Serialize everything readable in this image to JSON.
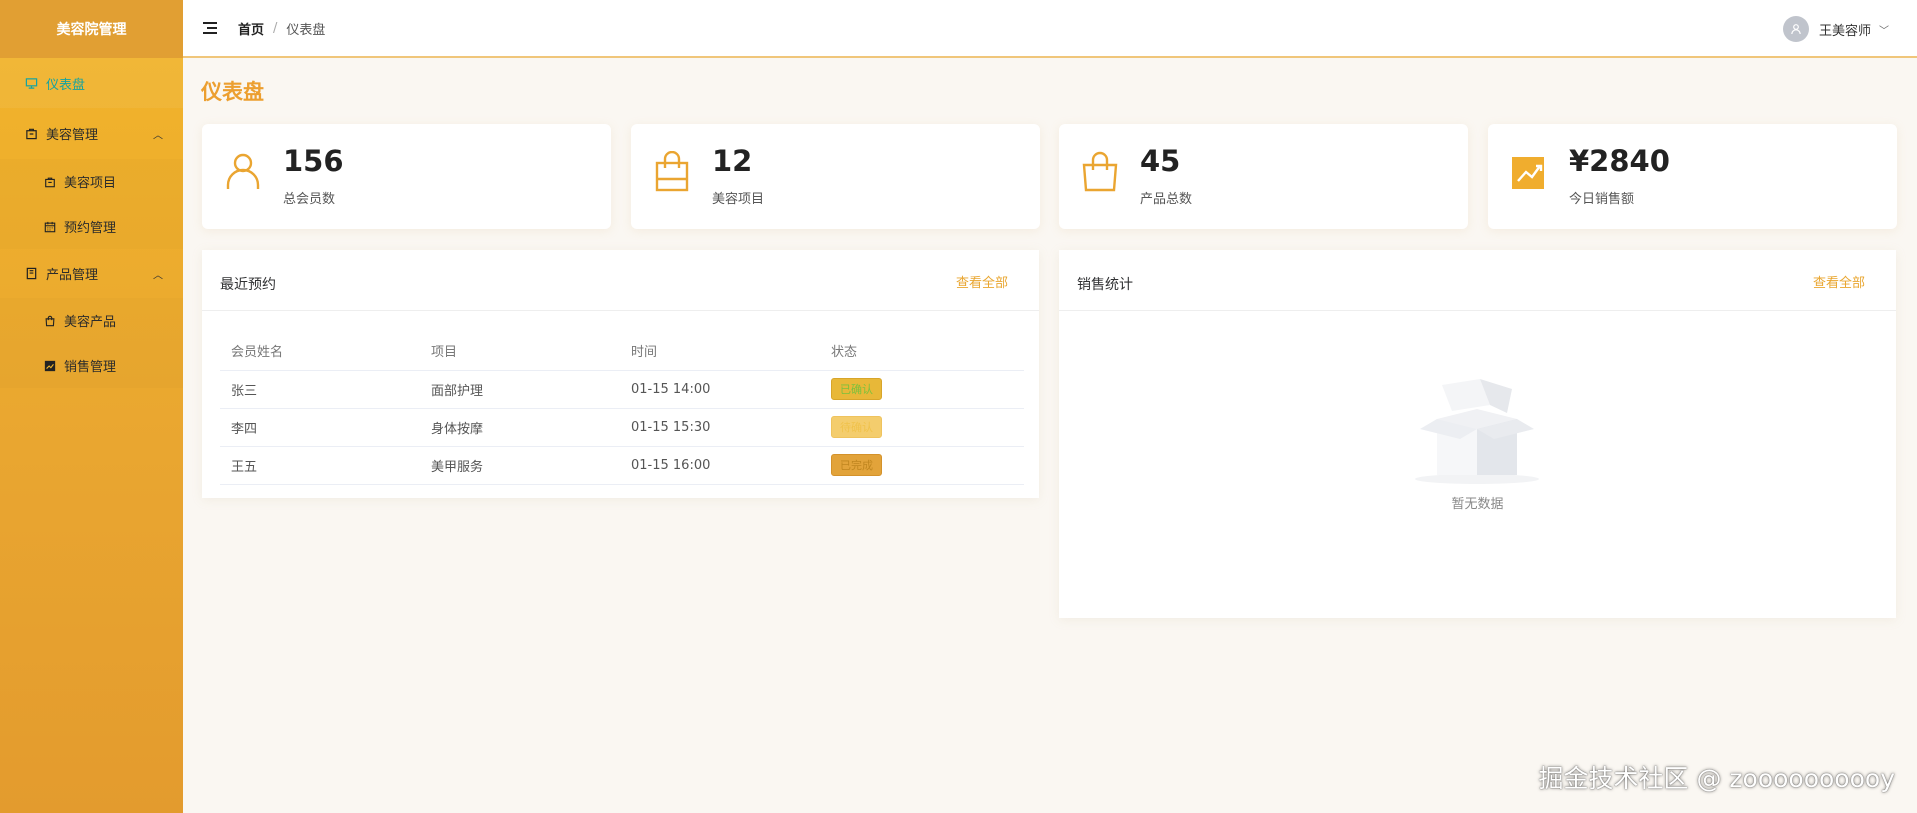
{
  "app": {
    "logo_text": "美容院管理"
  },
  "sidebar": {
    "items": [
      {
        "label": "仪表盘",
        "icon": "monitor-icon",
        "active": true
      },
      {
        "label": "美容管理",
        "icon": "bag-icon",
        "expanded": true,
        "children": [
          {
            "label": "美容项目",
            "icon": "bag-icon"
          },
          {
            "label": "预约管理",
            "icon": "calendar-icon"
          }
        ]
      },
      {
        "label": "产品管理",
        "icon": "notebook-icon",
        "expanded": true,
        "children": [
          {
            "label": "美容产品",
            "icon": "shopping-bag-icon"
          },
          {
            "label": "销售管理",
            "icon": "trend-chart-icon"
          }
        ]
      }
    ]
  },
  "header": {
    "breadcrumb": {
      "home": "首页",
      "separator": "/",
      "current": "仪表盘"
    },
    "user": {
      "name": "王美容师"
    }
  },
  "page": {
    "title": "仪表盘"
  },
  "stats": [
    {
      "value": "156",
      "label": "总会员数",
      "icon": "user-icon"
    },
    {
      "value": "12",
      "label": "美容项目",
      "icon": "bag-icon"
    },
    {
      "value": "45",
      "label": "产品总数",
      "icon": "shopping-bag-icon"
    },
    {
      "value": "¥2840",
      "label": "今日销售额",
      "icon": "trend-chart-icon"
    }
  ],
  "recent": {
    "title": "最近预约",
    "view_all": "查看全部",
    "columns": [
      "会员姓名",
      "项目",
      "时间",
      "状态"
    ],
    "rows": [
      {
        "name": "张三",
        "project": "面部护理",
        "time": "01-15 14:00",
        "status": "已确认"
      },
      {
        "name": "李四",
        "project": "身体按摩",
        "time": "01-15 15:30",
        "status": "待确认"
      },
      {
        "name": "王五",
        "project": "美甲服务",
        "time": "01-15 16:00",
        "status": "已完成"
      }
    ]
  },
  "sales": {
    "title": "销售统计",
    "view_all": "查看全部",
    "empty_text": "暂无数据"
  },
  "watermark": "掘金技术社区 @ zoooooooooy",
  "colors": {
    "accent": "#ec9f30",
    "sidebar_top": "#f2b52a",
    "active_menu": "#16a3a0"
  }
}
